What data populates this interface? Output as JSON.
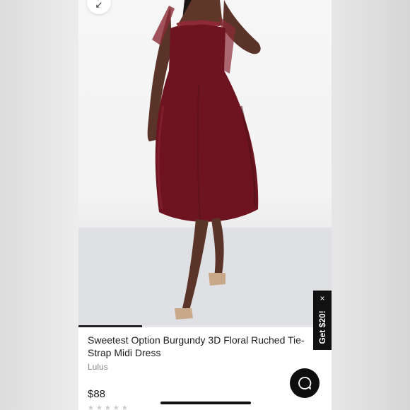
{
  "product": {
    "title": "Sweetest Option Burgundy 3D Floral Ruched Tie-Strap Midi Dress",
    "brand": "Lulus",
    "price": "$88",
    "rating_stars": "★★★★★",
    "image_alt": "Model wearing burgundy tulle midi dress with strappy heels"
  },
  "gallery": {
    "collapse_icon": "↙",
    "progress": 0.25
  },
  "promo": {
    "label": "Get $20!",
    "close_icon": "×"
  },
  "colors": {
    "dress": "#6e1420",
    "accent_dark": "#111111",
    "muted_text": "#888888"
  }
}
